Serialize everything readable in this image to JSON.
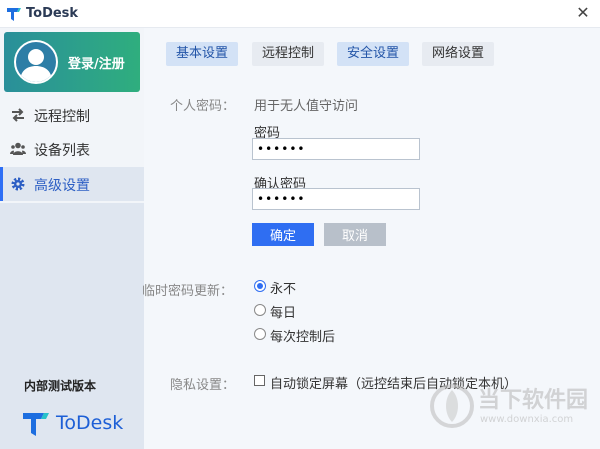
{
  "app": {
    "title": "ToDesk"
  },
  "window": {
    "close": "✕"
  },
  "sidebar": {
    "login": "登录/注册",
    "items": [
      {
        "label": "远程控制",
        "icon": "swap-arrows-icon"
      },
      {
        "label": "设备列表",
        "icon": "users-icon"
      },
      {
        "label": "高级设置",
        "icon": "gear-icon",
        "active": true
      }
    ],
    "version": "内部测试版本",
    "brand": "ToDesk"
  },
  "tabs": [
    {
      "label": "基本设置",
      "highlighted": true
    },
    {
      "label": "远程控制",
      "highlighted": false
    },
    {
      "label": "安全设置",
      "highlighted": true
    },
    {
      "label": "网络设置",
      "highlighted": false
    }
  ],
  "personal_password": {
    "label": "个人密码：",
    "desc": "用于无人值守访问",
    "password_label": "密码",
    "password_value": "••••••",
    "confirm_label": "确认密码",
    "confirm_value": "••••••",
    "ok": "确定",
    "cancel": "取消"
  },
  "temp_password": {
    "label": "临时密码更新：",
    "options": [
      "永不",
      "每日",
      "每次控制后"
    ],
    "selected": 0
  },
  "privacy": {
    "label": "隐私设置：",
    "checkbox_label": "自动锁定屏幕（远控结束后自动锁定本机）",
    "checked": false
  },
  "watermark": {
    "text": "当下软件园",
    "url": "www.downxia.com"
  },
  "colors": {
    "accent": "#2f6ef2",
    "login_start": "#2a8f9a",
    "login_end": "#2fae7e",
    "brand": "#1d5fd6"
  }
}
